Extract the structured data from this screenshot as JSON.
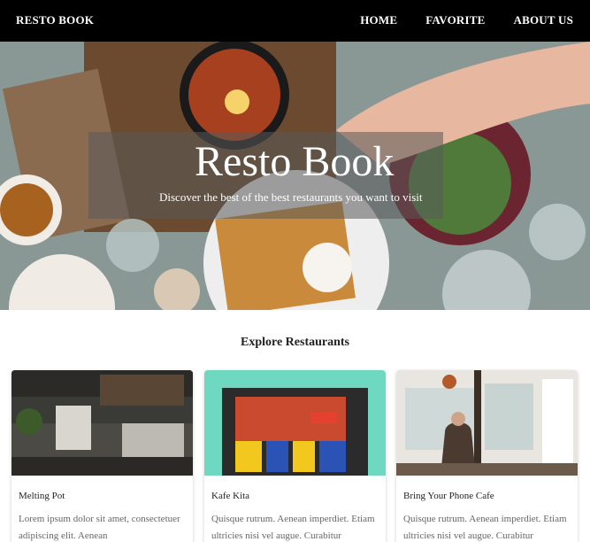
{
  "navbar": {
    "brand": "RESTO BOOK",
    "links": [
      "HOME",
      "FAVORITE",
      "ABOUT US"
    ]
  },
  "hero": {
    "title": "Resto Book",
    "subtitle": "Discover the best of the best restaurants you want to visit"
  },
  "explore": {
    "title": "Explore Restaurants",
    "restaurants": [
      {
        "name": "Melting Pot",
        "description": "Lorem ipsum dolor sit amet, consectetuer adipiscing elit. Aenean"
      },
      {
        "name": "Kafe Kita",
        "description": "Quisque rutrum. Aenean imperdiet. Etiam ultricies nisi vel augue. Curabitur"
      },
      {
        "name": "Bring Your Phone Cafe",
        "description": "Quisque rutrum. Aenean imperdiet. Etiam ultricies nisi vel augue. Curabitur"
      }
    ]
  },
  "colors": {
    "navbar": "#000000",
    "overlay": "#5a5a5a"
  }
}
